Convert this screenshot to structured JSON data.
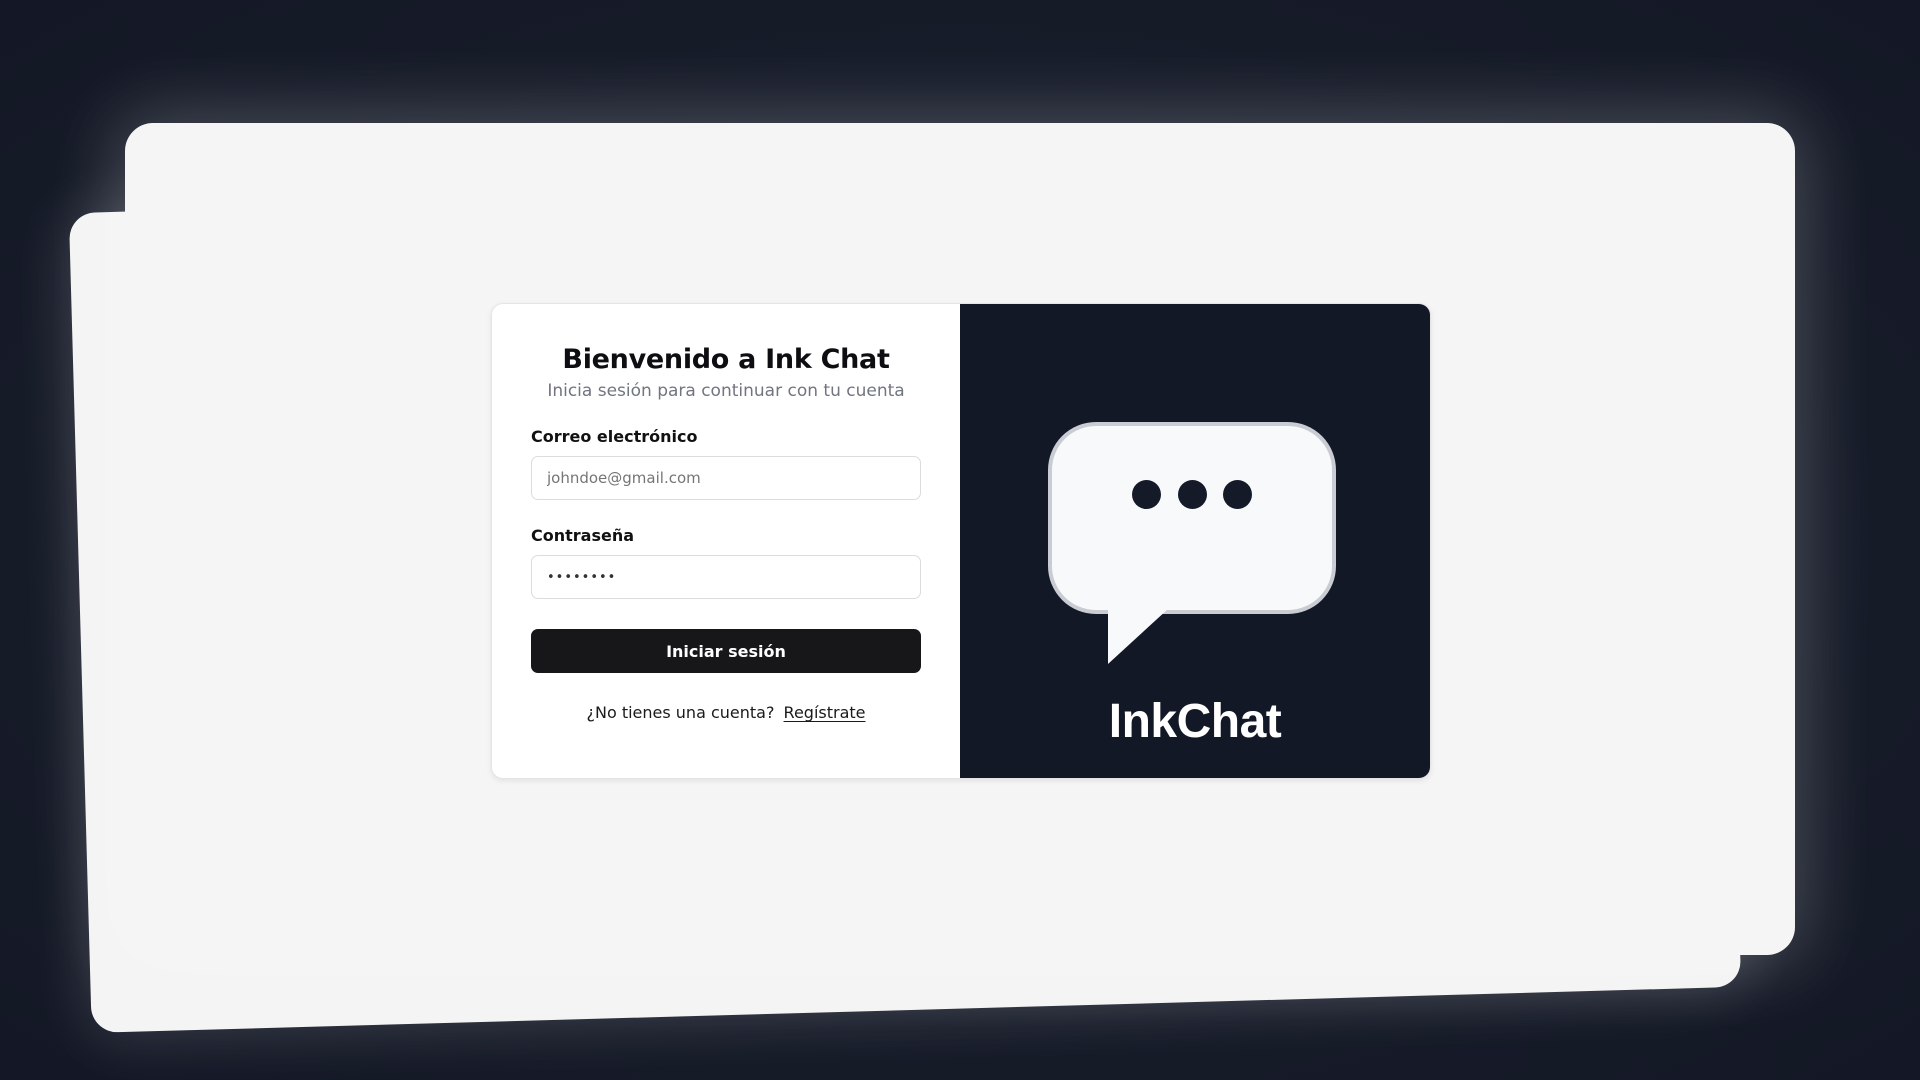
{
  "login": {
    "title": "Bienvenido a Ink Chat",
    "subtitle": "Inicia sesión para continuar con tu cuenta",
    "email_label": "Correo electrónico",
    "email_placeholder": "johndoe@gmail.com",
    "password_label": "Contraseña",
    "password_value": "••••••••",
    "submit_label": "Iniciar sesión",
    "signup_prompt": "¿No tienes una cuenta?",
    "signup_link": "Regístrate"
  },
  "brand": {
    "name": "InkChat",
    "logo_icon": "chat-bubble-typing-icon"
  },
  "colors": {
    "page_background": "#171c2b",
    "window_background": "#f5f5f5",
    "brand_panel": "#131827",
    "button_background": "#17171a",
    "bubble_fill": "#f8f9fb"
  }
}
